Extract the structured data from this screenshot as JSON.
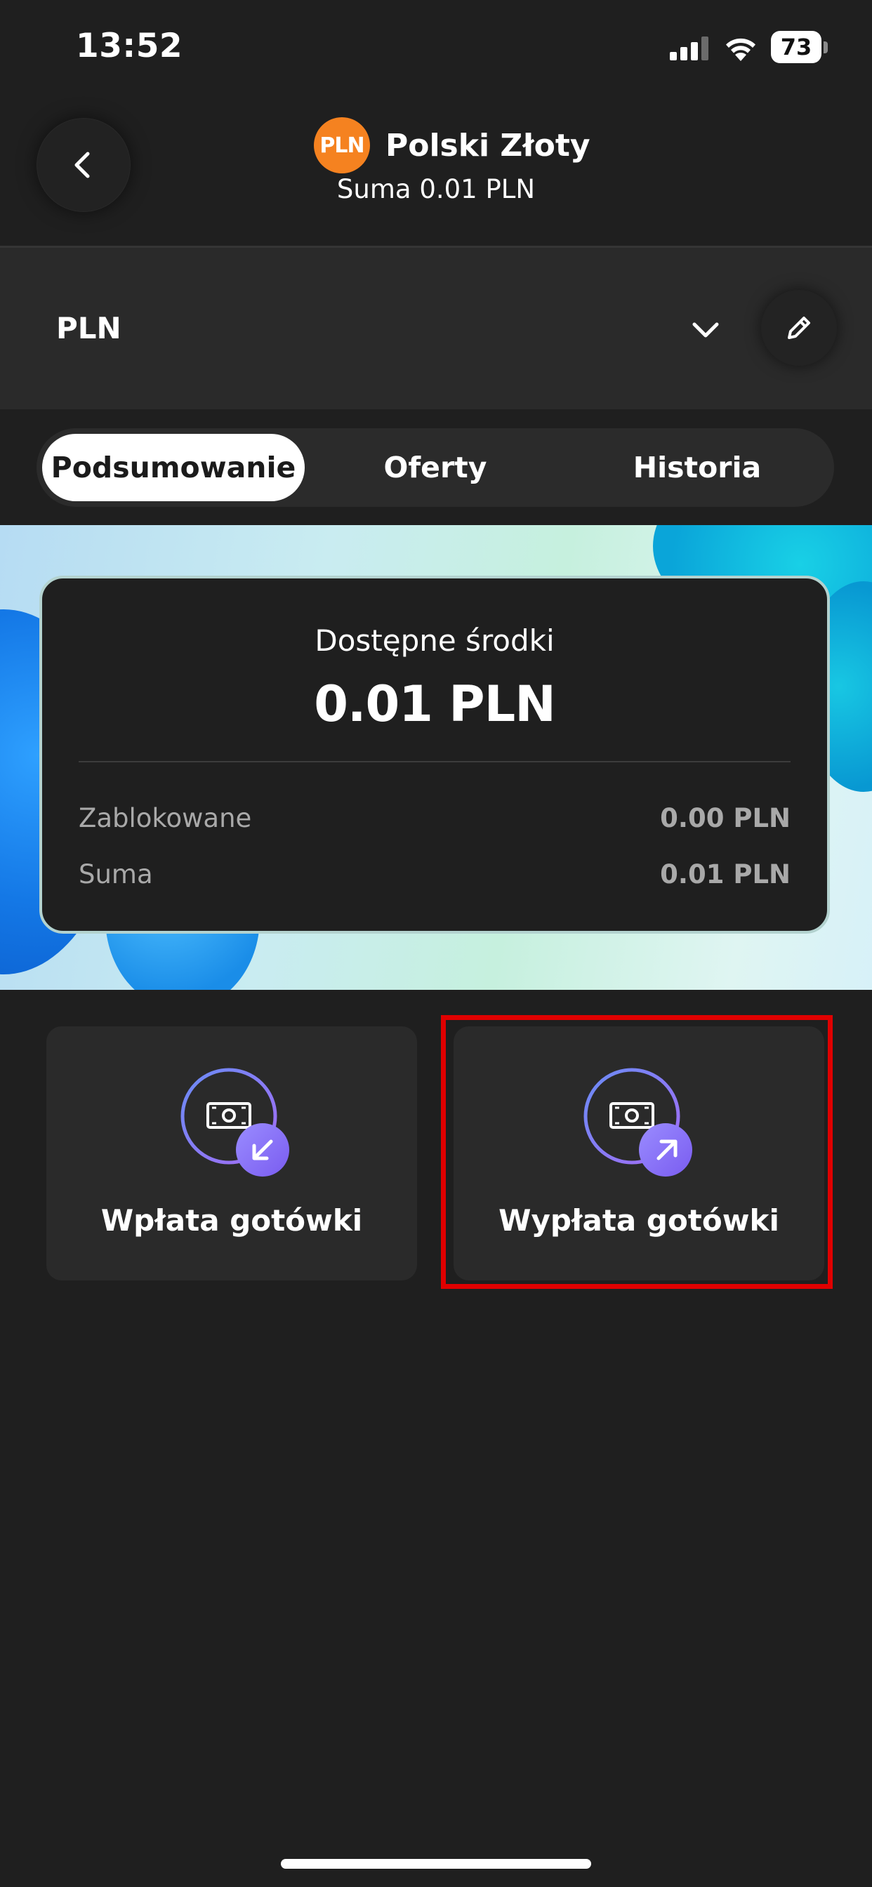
{
  "status_bar": {
    "time": "13:52",
    "battery": "73",
    "icons": [
      "signal-icon",
      "wifi-icon",
      "battery-icon"
    ]
  },
  "header": {
    "currency_badge": "PLN",
    "currency_name": "Polski Złoty",
    "subtitle": "Suma 0.01 PLN",
    "badge_color": "#f58220"
  },
  "account": {
    "label": "PLN"
  },
  "tabs": [
    {
      "label": "Podsumowanie",
      "active": true
    },
    {
      "label": "Oferty",
      "active": false
    },
    {
      "label": "Historia",
      "active": false
    }
  ],
  "balance_card": {
    "label": "Dostępne środki",
    "amount": "0.01 PLN",
    "rows": [
      {
        "label": "Zablokowane",
        "value": "0.00 PLN"
      },
      {
        "label": "Suma",
        "value": "0.01 PLN"
      }
    ]
  },
  "actions": [
    {
      "label": "Wpłata gotówki",
      "icon": "cash-deposit-icon"
    },
    {
      "label": "Wypłata gotówki",
      "icon": "cash-withdraw-icon",
      "highlighted": true
    }
  ],
  "colors": {
    "background": "#1f1f1f",
    "surface": "#2a2a2a",
    "accent_purple": "#8a6cf5",
    "accent_blue": "#6a8cf5",
    "highlight_red": "#e00000"
  }
}
